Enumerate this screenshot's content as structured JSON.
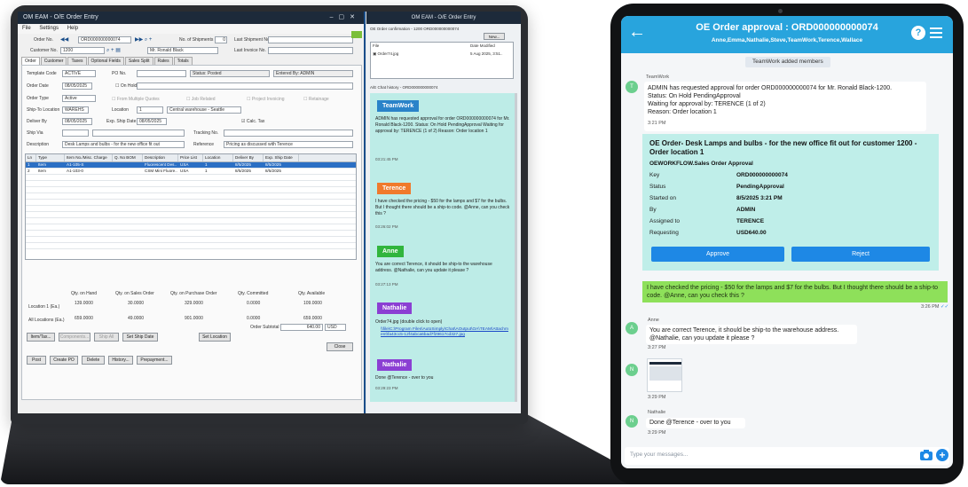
{
  "laptop": {
    "window_title": "OM EAM - O/E Order Entry",
    "menu": [
      "File",
      "Settings",
      "Help"
    ],
    "header": {
      "order_no_label": "Order No.",
      "order_no": "ORD000000000074",
      "customer_no_label": "Customer No.",
      "customer_no": "1200",
      "customer_name": "Mr. Ronald Black",
      "shipments_label": "No. of Shipments",
      "shipments": "0",
      "last_shipment_label": "Last Shipment No.",
      "last_invoice_label": "Last Invoice No."
    },
    "tabs": [
      "Order",
      "Customer",
      "Taxes",
      "Optional Fields",
      "Sales Split",
      "Rates",
      "Totals"
    ],
    "form": {
      "template_label": "Template Code",
      "template": "ACTIVE",
      "po_label": "PO No.",
      "status_text": "Status: Posted",
      "entered_by": "Entered By: ADMIN",
      "order_date_label": "Order Date",
      "order_date": "08/05/2025",
      "on_hold": "On Hold",
      "order_type_label": "Order Type",
      "order_type": "Active",
      "from_quotes": "From Multiple Quotes",
      "job_related": "Job Related",
      "project_invoicing": "Project Invoicing",
      "retainage": "Retainage",
      "ship_to_label": "Ship-To Location",
      "ship_to": "WAREHS",
      "location_label": "Location",
      "location": "1",
      "location_name": "Central warehouse - Seattle",
      "deliver_label": "Deliver By",
      "deliver": "08/05/2025",
      "exp_ship_label": "Exp. Ship Date",
      "exp_ship": "08/05/2025",
      "calc_tax": "Calc. Tax",
      "ship_via_label": "Ship Via",
      "tracking_label": "Tracking No.",
      "desc_label": "Description",
      "desc": "Desk Lamps and bulbs - for the new office fit out",
      "reference_label": "Reference",
      "reference": "Pricing as discussed with Terence"
    },
    "grid": {
      "headers": [
        "Ln",
        "Type",
        "Item No./Misc. Charge",
        "Q. No BOM",
        "Description",
        "Price List",
        "Location",
        "Deliver By",
        "Exp. Ship Date"
      ],
      "rows": [
        [
          "1",
          "Item",
          "A1-105-S",
          "",
          "Fluorescent Des..",
          "USA",
          "1",
          "8/5/2025",
          "8/5/2025"
        ],
        [
          "2",
          "Item",
          "A1-103-0",
          "",
          "CSM Mini Fluore..",
          "USA",
          "1",
          "8/5/2025",
          "8/5/2025"
        ]
      ]
    },
    "qty": {
      "on_hand_label": "Qty. on Hand",
      "on_sales_label": "Qty. on Sales Order",
      "on_po_label": "Qty. on Purchase Order",
      "committed_label": "Qty. Committed",
      "available_label": "Qty. Available",
      "loc_label": "Location 1 (Ea.)",
      "all_label": "All Locations (Ea.)",
      "loc_vals": [
        "139.0000",
        "30.0000",
        "329.0000",
        "0.0000",
        "109.0000"
      ],
      "all_vals": [
        "659.0000",
        "49.0000",
        "901.0000",
        "0.0000",
        "659.0000"
      ]
    },
    "subtotal_label": "Order Subtotal",
    "subtotal": "640.00",
    "currency": "USD",
    "buttons_row1": [
      "Item/Tax...",
      "Components...",
      "Ship All",
      "Set Ship Date",
      "Set Location",
      "Close"
    ],
    "buttons_row2": [
      "Post",
      "Create PO",
      "Delete",
      "History...",
      "Prepayment..."
    ],
    "sidebar": {
      "title": "OM EAM - O/E Order Entry",
      "file_panel_title": "OE Order confirmation - 1200 ORD000000000074",
      "new_btn": "New...",
      "file_col": "File",
      "date_col": "Date Modified",
      "file_name": "Order74.jpg",
      "file_date": "5 Aug 2025, 3:51..",
      "history_title": "A/E Chat history - ORD000000000074",
      "messages": [
        {
          "who": "TeamWork",
          "color": "#2a83c9",
          "text": "ADMIN has requested approval for order ORD000000000074 for Mr. Ronald Black-1200. Status: On Hold PendingApproval Waiting for approval by: TERENCE (1 of 2) Reason: Order location 1",
          "time": "03:21:45 PM"
        },
        {
          "who": "Terence",
          "color": "#f07a2c",
          "text": "I have checked the pricing - $50 for the lamps and $7 for the bulbs. But I thought there should be a ship-to code. @Anne, can you check this ?",
          "time": "03:26:02 PM"
        },
        {
          "who": "Anne",
          "color": "#31b53d",
          "text": "You are correct Terence, it should be ship-to the warehouse address. @Nathalie, can you update it please ?",
          "time": "03:27:13 PM"
        },
        {
          "who": "Nathalie",
          "color": "#8b3fd3",
          "text": "Order74.jpg (double click to open)",
          "link": "\\\\file\\C:\\Program Files\\AutoSimply\\Chat\\AOutput\\OA\\TEAM\\Attachment\\fa43cc5-12f4abca6bad7f29617cd327.jpg",
          "time": ""
        },
        {
          "who": "Nathalie",
          "color": "#8b3fd3",
          "text": "Done @Terence - over to you",
          "time": "03:29:23 PM"
        }
      ]
    }
  },
  "tablet": {
    "title": "OE Order approval : ORD000000000074",
    "subtitle": "Anne,Emma,Nathalie,Steve,TeamWork,Terence,Wallace",
    "system_msg": "TeamWork added members",
    "m1": {
      "who": "TeamWork",
      "initial": "T",
      "l1": "ADMIN has requested approval for order ORD000000000074 for Mr. Ronald Black-1200.",
      "l2": "Status: On Hold PendingApproval",
      "l3": "Waiting for approval by: TERENCE (1 of 2)",
      "l4": "Reason: Order location 1",
      "time": "3:21 PM"
    },
    "card": {
      "heading": "OE Order- Desk Lamps and bulbs - for the new office fit out  for customer 1200 - Order location 1",
      "workflow": "OEWORKFLOW.Sales Order Approval",
      "rows": [
        {
          "k": "Key",
          "v": "ORD000000000074"
        },
        {
          "k": "Status",
          "v": "PendingApproval"
        },
        {
          "k": "Started on",
          "v": "8/5/2025 3:21 PM"
        },
        {
          "k": "By",
          "v": "ADMIN"
        },
        {
          "k": "Assigned to",
          "v": "TERENCE"
        },
        {
          "k": "Requesting",
          "v": "USD640.00"
        }
      ],
      "approve": "Approve",
      "reject": "Reject"
    },
    "m2": {
      "text": "I have checked the pricing - $50 for the lamps and $7 for the bulbs.  But I thought there should be a ship-to code.  @Anne, can you check this ?",
      "time": "3:26 PM"
    },
    "m3": {
      "who": "Anne",
      "initial": "A",
      "text": "You are correct Terence, it should be ship-to the warehouse address.  @Nathalie, can you update it please ?",
      "time": "3:27 PM"
    },
    "m4": {
      "initial": "N",
      "time": "3:29 PM"
    },
    "m5": {
      "who": "Nathalie",
      "initial": "N",
      "text": "Done @Terence - over to you",
      "time": "3:29 PM"
    },
    "input_placeholder": "Type your messages..."
  },
  "colors": {
    "tablet_header": "#28a4dd",
    "approve": "#1e88e5",
    "green_bubble": "#8ee05a",
    "card_bg": "#bfeee9"
  }
}
